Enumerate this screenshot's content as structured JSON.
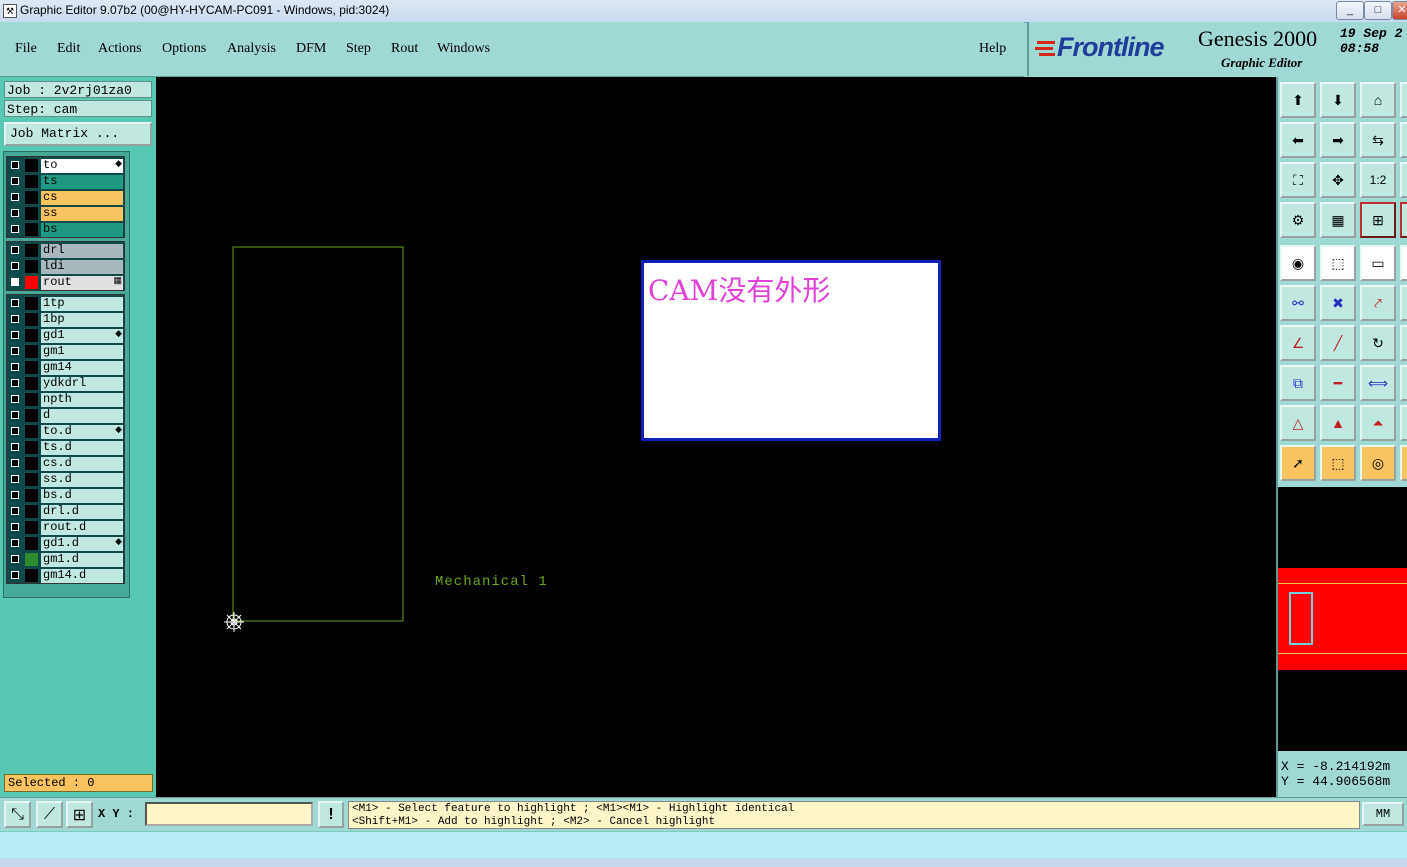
{
  "window": {
    "title": "Graphic Editor 9.07b2 (00@HY-HYCAM-PC091 - Windows, pid:3024)",
    "controls": [
      "_",
      "□",
      "✕"
    ]
  },
  "menu": {
    "items": [
      "File",
      "Edit",
      "Actions",
      "Options",
      "Analysis",
      "DFM",
      "Step",
      "Rout",
      "Windows"
    ],
    "help": "Help"
  },
  "branding": {
    "logo": "Frontline",
    "product": "Genesis 2000",
    "subtitle": "Graphic Editor",
    "date": "19 Sep 2",
    "time": "08:58"
  },
  "job": {
    "job_label": "Job : 2v2rj01za0",
    "step_label": "Step: cam",
    "matrix_button": "Job Matrix ..."
  },
  "layers": {
    "group1": [
      {
        "name": "to",
        "color": "#ffffff",
        "mark": "◆"
      },
      {
        "name": "ts",
        "color": "#1f9a82",
        "mark": ""
      },
      {
        "name": "cs",
        "color": "#f9c45f",
        "mark": ""
      },
      {
        "name": "ss",
        "color": "#f9c45f",
        "mark": ""
      },
      {
        "name": "bs",
        "color": "#1f9a82",
        "mark": ""
      }
    ],
    "group2": [
      {
        "name": "drl",
        "color": "#a9b8bd",
        "mark": ""
      },
      {
        "name": "ldi",
        "color": "#a9b8bd",
        "mark": ""
      },
      {
        "name": "rout",
        "color": "#e0e0e0",
        "mark": "▦",
        "active": true
      }
    ],
    "group3": [
      {
        "name": "1tp",
        "mark": ""
      },
      {
        "name": "1bp",
        "mark": ""
      },
      {
        "name": "gd1",
        "mark": "◆"
      },
      {
        "name": "gm1",
        "mark": ""
      },
      {
        "name": "gm14",
        "mark": ""
      },
      {
        "name": "ydkdrl",
        "mark": ""
      },
      {
        "name": "npth",
        "mark": ""
      },
      {
        "name": "d",
        "mark": ""
      },
      {
        "name": "to.d",
        "mark": "◆"
      },
      {
        "name": "ts.d",
        "mark": ""
      },
      {
        "name": "cs.d",
        "mark": ""
      },
      {
        "name": "ss.d",
        "mark": ""
      },
      {
        "name": "bs.d",
        "mark": ""
      },
      {
        "name": "drl.d",
        "mark": ""
      },
      {
        "name": "rout.d",
        "mark": ""
      },
      {
        "name": "gd1.d",
        "mark": "◆"
      },
      {
        "name": "gm1.d",
        "mark": "",
        "swatch": "#2e8b2e"
      },
      {
        "name": "gm14.d",
        "mark": ""
      }
    ]
  },
  "selected": "Selected : 0",
  "canvas": {
    "annotation_text": "CAM没有外形",
    "mechanical_label": "Mechanical 1",
    "outline_color": "#6aa61e"
  },
  "coords": {
    "x": "X = -8.214192m",
    "y": "Y = 44.906568m"
  },
  "bottom": {
    "xy_label": "X Y :",
    "xy_value": "",
    "message_line1": "<M1> - Select feature to highlight ; <M1><M1> - Highlight identical",
    "message_line2": "<Shift+M1> - Add to highlight ; <M2> - Cancel highlight",
    "unit": "MM"
  }
}
